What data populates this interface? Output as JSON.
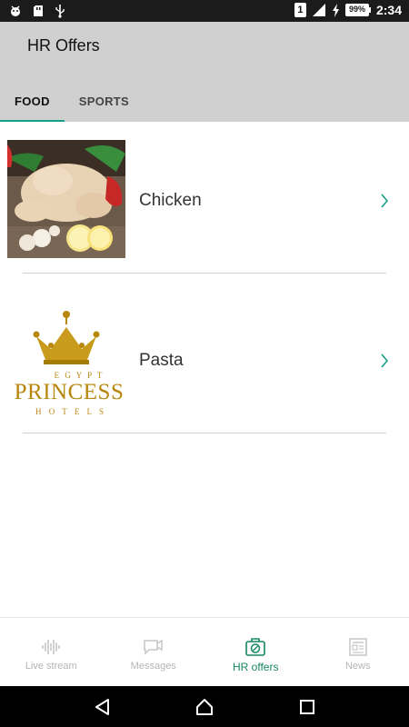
{
  "status_bar": {
    "sim_number": "1",
    "battery_percent": "99%",
    "time": "2:34"
  },
  "app_bar": {
    "title": "HR Offers"
  },
  "tabs": [
    {
      "label": "FOOD",
      "active": true
    },
    {
      "label": "SPORTS",
      "active": false
    }
  ],
  "offers": [
    {
      "label": "Chicken",
      "image": "chicken-photo"
    },
    {
      "label": "Pasta",
      "image": "princess-hotels-logo"
    }
  ],
  "princess_logo_text": {
    "top": "E G Y P T",
    "main": "PRINCESS",
    "bottom": "H O T E L S"
  },
  "bottom_nav": [
    {
      "label": "Live stream",
      "icon": "live-stream-icon",
      "active": false
    },
    {
      "label": "Messages",
      "icon": "messages-icon",
      "active": false
    },
    {
      "label": "HR offers",
      "icon": "hr-offers-icon",
      "active": true
    },
    {
      "label": "News",
      "icon": "news-icon",
      "active": false
    }
  ],
  "colors": {
    "accent": "#16a085",
    "active_nav": "#16875f",
    "app_bar": "#d0d0d0",
    "status_bar": "#1b1b1b"
  }
}
